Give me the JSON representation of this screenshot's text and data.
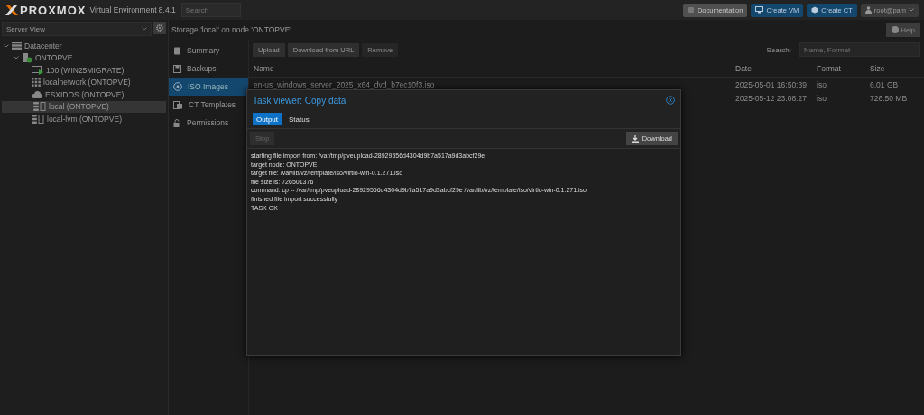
{
  "header": {
    "logo": "PROXMOX",
    "product": "Virtual Environment 8.4.1",
    "search": {
      "placeholder": "Search"
    },
    "buttons": [
      {
        "label": "Documentation",
        "kind": "doc"
      },
      {
        "label": "Create VM",
        "kind": "vm"
      },
      {
        "label": "Create CT",
        "kind": "ct"
      },
      {
        "label": "root@pam",
        "kind": "user"
      }
    ]
  },
  "sidebar": {
    "view": "Server View",
    "tree": [
      {
        "label": "Datacenter",
        "kind": "datacenter",
        "selected": false,
        "children": [
          {
            "label": "ONTOPVE",
            "kind": "node",
            "selected": false,
            "children": [
              {
                "label": "100 (WIN25MIGRATE)",
                "kind": "vm",
                "selected": false
              },
              {
                "label": "localnetwork (ONTOPVE)",
                "kind": "network",
                "selected": false
              },
              {
                "label": "ESXIDOS (ONTOPVE)",
                "kind": "cloud",
                "selected": false
              },
              {
                "label": "local (ONTOPVE)",
                "kind": "storage",
                "selected": true
              },
              {
                "label": "local-lvm (ONTOPVE)",
                "kind": "storage",
                "selected": false
              }
            ]
          }
        ]
      }
    ]
  },
  "content": {
    "title": "Storage 'local' on node 'ONTOPVE'",
    "help": "Help",
    "menu": [
      {
        "label": "Summary",
        "kind": "summary",
        "selected": false
      },
      {
        "label": "Backups",
        "kind": "backup",
        "selected": false
      },
      {
        "label": "ISO Images",
        "kind": "iso",
        "selected": true
      },
      {
        "label": "CT Templates",
        "kind": "template",
        "selected": false
      },
      {
        "label": "Permissions",
        "kind": "lock",
        "selected": false
      }
    ],
    "toolbar": [
      {
        "label": "Upload",
        "disabled": false
      },
      {
        "label": "Download from URL",
        "disabled": false
      },
      {
        "label": "Remove",
        "disabled": true
      }
    ],
    "search": {
      "label": "Search:",
      "placeholder": "Name, Format"
    },
    "table": {
      "columns": [
        "Name",
        "Date",
        "Format",
        "Size"
      ],
      "rows": [
        {
          "name": "en-us_windows_server_2025_x64_dvd_b7ec10f3.iso",
          "date": "2025-05-01 16:50:39",
          "format": "iso",
          "size": "6.01 GB"
        },
        {
          "date": "2025-05-12 23:08:27",
          "format": "iso",
          "size": "726.50 MB"
        }
      ]
    }
  },
  "dialog": {
    "title": "Task viewer: Copy data",
    "tabs": [
      {
        "label": "Output",
        "selected": true
      },
      {
        "label": "Status",
        "selected": false
      }
    ],
    "stop": {
      "label": "Stop",
      "disabled": true
    },
    "download": "Download",
    "log": [
      "starting file import from: /var/tmp/pveupload-28929556d4304d9b7a517a9d3abcf29e",
      "target node: ONTOPVE",
      "target file: /var/lib/vz/template/iso/virtio-win-0.1.271.iso",
      "file size is: 726501376",
      "command: cp -- /var/tmp/pveupload-28929556d4304d9b7a517a9d3abcf29e /var/lib/vz/template/iso/virtio-win-0.1.271.iso",
      "finished file import successfully",
      "TASK OK"
    ]
  }
}
